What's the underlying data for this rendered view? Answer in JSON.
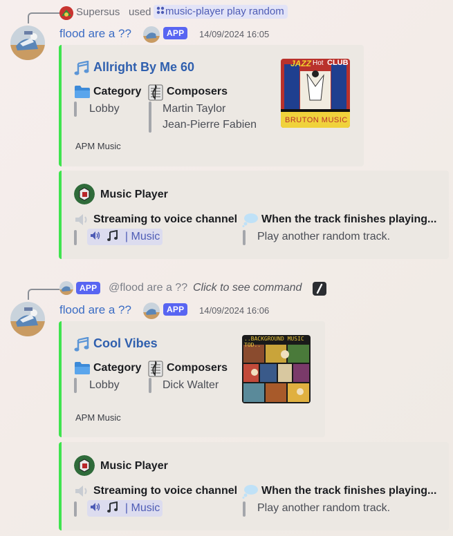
{
  "messages": [
    {
      "reply": {
        "user": "Supersus",
        "used_text": "used",
        "command": "music-player play random"
      },
      "author": {
        "name": "flood are a ??",
        "badge": "APP"
      },
      "timestamp": "14/09/2024 16:05",
      "track_embed": {
        "title": "Allright By Me 60",
        "category_label": "Category",
        "category_value": "Lobby",
        "composers_label": "Composers",
        "composers": [
          "Martin Taylor",
          "Jean-Pierre Fabien"
        ],
        "footer": "APM Music",
        "thumbnail": "album-cover-jazz-hot-club",
        "thumbnail_text": [
          "JAZZ",
          "Hot",
          "CLUB",
          "BRUTON MUSIC"
        ],
        "accent_color": "#3fe34e"
      },
      "player_embed": {
        "author": "Music Player",
        "streaming_label": "Streaming to voice channel",
        "channel_name": "Music",
        "finish_label": "When the track finishes playing...",
        "finish_value": "Play another random track."
      }
    },
    {
      "reply": {
        "badge": "APP",
        "mention": "@flood are a ??",
        "click_text": "Click to see command"
      },
      "author": {
        "name": "flood are a ??",
        "badge": "APP"
      },
      "timestamp": "14/09/2024 16:06",
      "track_embed": {
        "title": "Cool Vibes",
        "category_label": "Category",
        "category_value": "Lobby",
        "composers_label": "Composers",
        "composers": [
          "Dick Walter"
        ],
        "footer": "APM Music",
        "thumbnail": "album-cover-background-music-collage",
        "thumbnail_text": [
          "..BACKGROUND MUSIC TOD.."
        ],
        "accent_color": "#3fe34e"
      },
      "player_embed": {
        "author": "Music Player",
        "streaming_label": "Streaming to voice channel",
        "channel_name": "Music",
        "finish_label": "When the track finishes playing...",
        "finish_value": "Play another random track."
      }
    }
  ]
}
